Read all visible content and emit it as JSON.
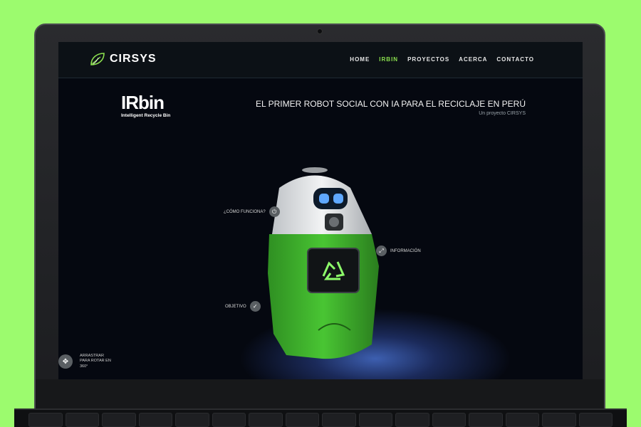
{
  "logo": {
    "text": "CIRSYS"
  },
  "nav": {
    "items": [
      "HOME",
      "IRBIN",
      "PROYECTOS",
      "ACERCA",
      "CONTACTO"
    ],
    "active": "IRBIN"
  },
  "brand": {
    "name": "IRbin",
    "tagline": "Intelligent Recycle Bin"
  },
  "headline": {
    "title": "EL PRIMER ROBOT SOCIAL CON IA PARA EL RECICLAJE EN PERÚ",
    "subtitle": "Un proyecto CIRSYS"
  },
  "hotspots": {
    "how": "¿CÓMO FUNCIONA?",
    "info": "INFORMACIÓN",
    "goal": "OBJETIVO"
  },
  "drag": {
    "text": "ARRASTRAR PARA ROTAR EN 360°"
  },
  "colors": {
    "accent": "#8be04e",
    "background": "#9cfb6e",
    "robot_green": "#3bb82a"
  },
  "icons": {
    "hotspot_how": "power-icon",
    "hotspot_info": "expand-icon",
    "hotspot_goal": "check-icon",
    "drag": "move-icon",
    "robot_screen": "recycle-icon"
  }
}
